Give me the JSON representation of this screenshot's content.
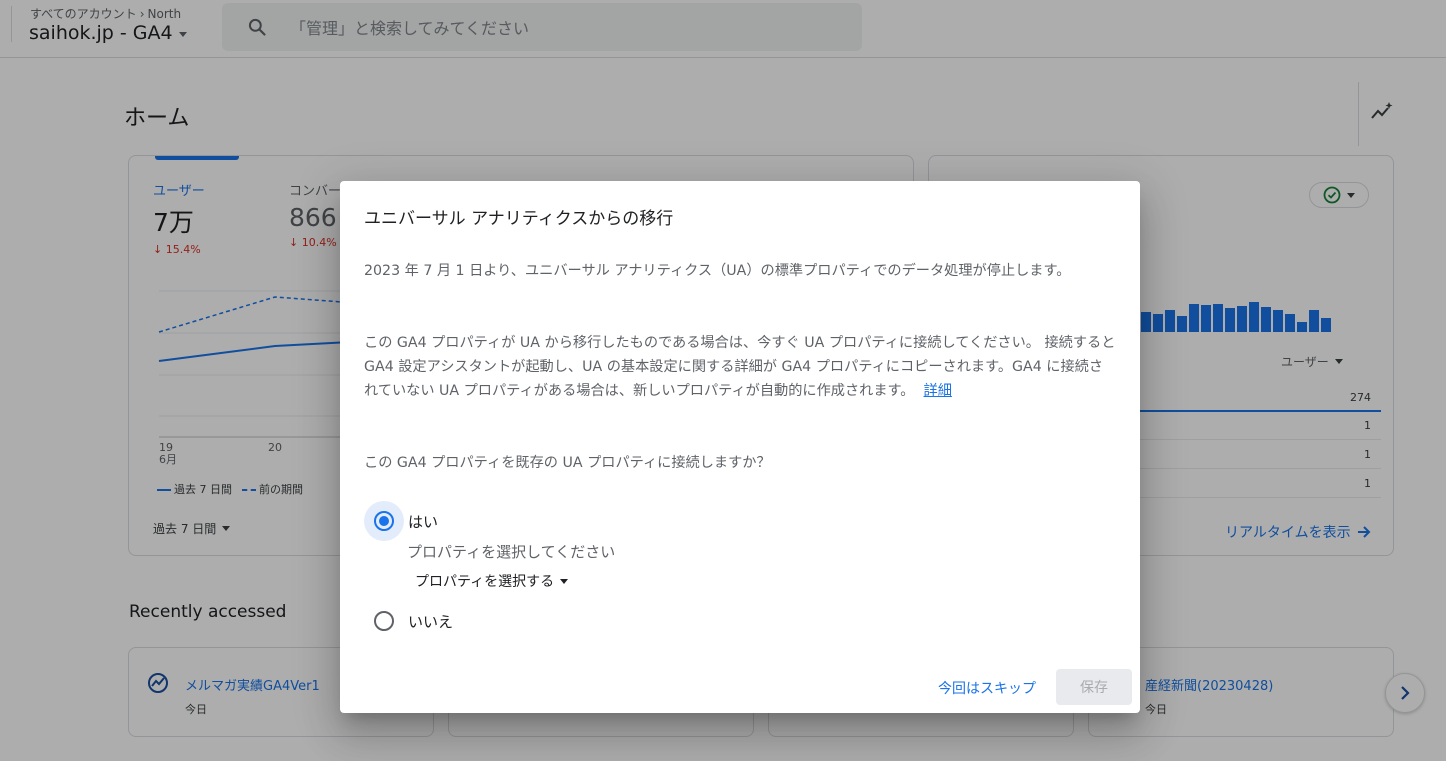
{
  "header": {
    "breadcrumb_root": "すべてのアカウント",
    "breadcrumb_leaf": "North",
    "property_name": "saihok.jp - GA4",
    "search_placeholder": "「管理」と検索してみてください"
  },
  "page": {
    "title": "ホーム",
    "overview_card": {
      "metrics": [
        {
          "label": "ユーザー",
          "value": "7万",
          "delta": "15.4%"
        },
        {
          "label": "コンバー",
          "value": "866",
          "delta": "10.4%"
        }
      ],
      "x_ticks": [
        {
          "day": "19",
          "month": "6月"
        },
        {
          "day": "20",
          "month": ""
        }
      ],
      "legend": {
        "current": "過去 7 日間",
        "previous": "前の期間"
      },
      "range_label": "過去 7 日間"
    },
    "realtime_card": {
      "column_header": "ユーザー",
      "rows": [
        "274",
        "1",
        "1",
        "1"
      ],
      "link_label": "リアルタイムを表示"
    },
    "recent": {
      "title": "Recently accessed",
      "items": [
        {
          "name": "メルマガ実績GA4Ver1",
          "date": "今日"
        },
        {
          "name": "",
          "date": ""
        },
        {
          "name": "",
          "date": ""
        },
        {
          "name": "産経新聞(20230428)",
          "date": "今日"
        }
      ]
    }
  },
  "dialog": {
    "title": "ユニバーサル アナリティクスからの移行",
    "para1": "2023 年 7 月 1 日より、ユニバーサル アナリティクス（UA）の標準プロパティでのデータ処理が停止します。",
    "para2": "この GA4 プロパティが UA から移行したものである場合は、今すぐ UA プロパティに接続してください。 接続すると GA4 設定アシスタントが起動し、UA の基本設定に関する詳細が GA4 プロパティにコピーされます。GA4 に接続されていない UA プロパティがある場合は、新しいプロパティが自動的に作成されます。",
    "details_link": "詳細",
    "question": "この GA4 プロパティを既存の UA プロパティに接続しますか？",
    "option_yes": "はい",
    "yes_hint": "プロパティを選択してください",
    "select_label": "プロパティを選択する",
    "option_no": "いいえ",
    "skip_label": "今回はスキップ",
    "save_label": "保存"
  },
  "colors": {
    "accent": "#1a73e8",
    "negative": "#d93025",
    "scrim": "rgba(0,0,0,0.32)"
  }
}
